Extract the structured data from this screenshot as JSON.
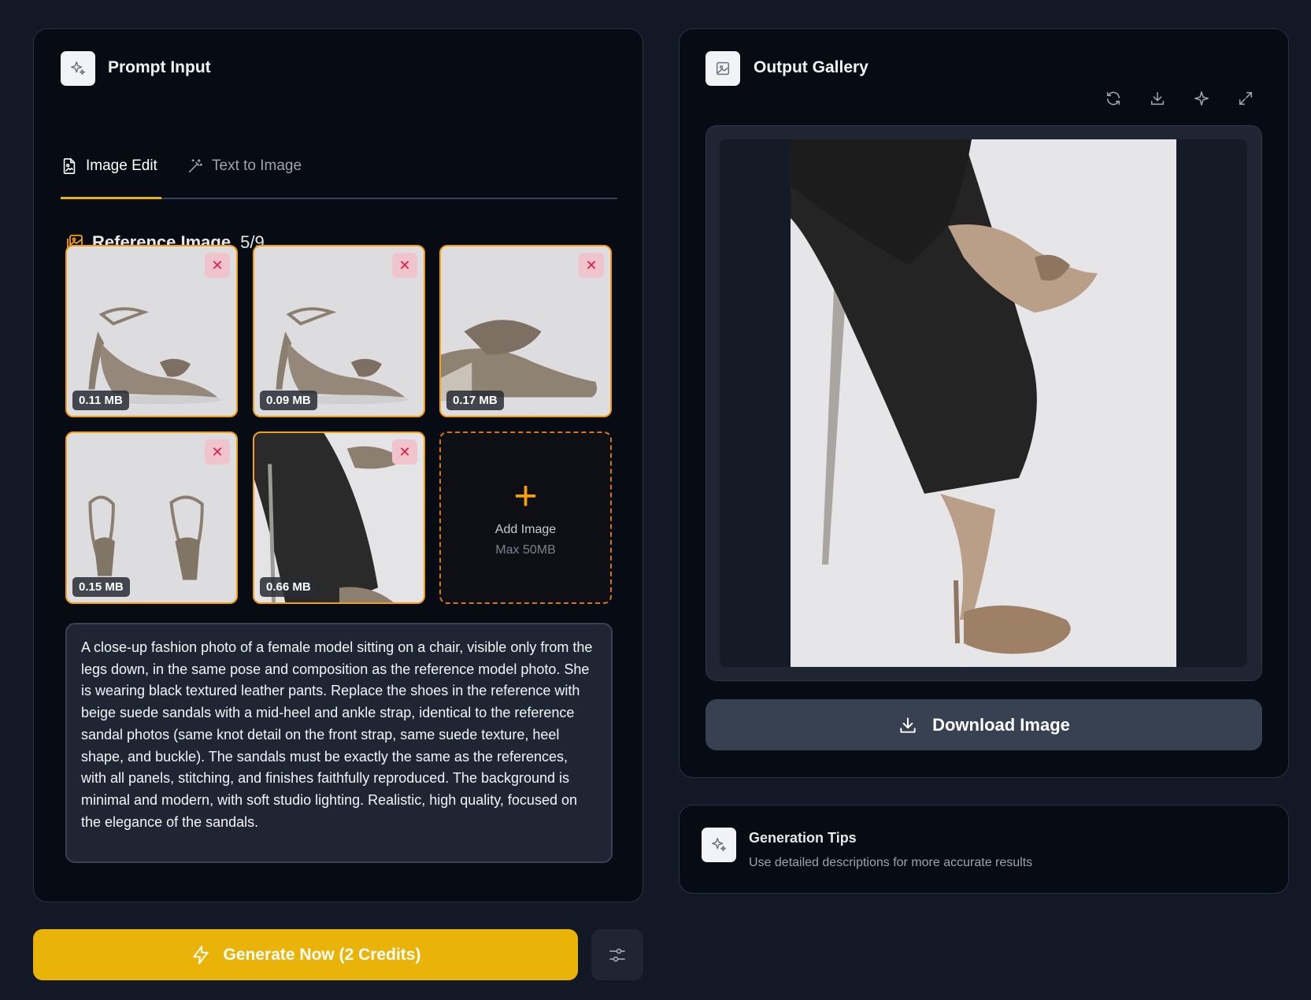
{
  "prompt_panel": {
    "title": "Prompt Input",
    "tabs": [
      {
        "label": "Image Edit",
        "active": true
      },
      {
        "label": "Text to Image",
        "active": false
      }
    ],
    "reference": {
      "label": "Reference Image",
      "count": "5/9",
      "images": [
        {
          "size": "0.11 MB",
          "subject": "sandal side view"
        },
        {
          "size": "0.09 MB",
          "subject": "sandal side view"
        },
        {
          "size": "0.17 MB",
          "subject": "sandal close-up"
        },
        {
          "size": "0.15 MB",
          "subject": "sandals back view"
        },
        {
          "size": "0.66 MB",
          "subject": "model legs leather pants"
        }
      ],
      "add_tile": {
        "label": "Add Image",
        "sublabel": "Max 50MB"
      }
    },
    "prompt_text": "A close-up fashion photo of a female model sitting on a chair, visible only from the legs down, in the same pose and composition as the reference model photo. She is wearing black textured leather pants. Replace the shoes in the reference with beige suede sandals with a mid-heel and ankle strap, identical to the reference sandal photos (same knot detail on the front strap, same suede texture, heel shape, and buckle). The sandals must be exactly the same as the references, with all panels, stitching, and finishes faithfully reproduced. The background is minimal and modern, with soft studio lighting. Realistic, high quality, focused on the elegance of the sandals."
  },
  "generate": {
    "label": "Generate Now (2 Credits)"
  },
  "gallery": {
    "title": "Output Gallery",
    "actions": [
      "refresh-icon",
      "download-icon",
      "sparkle-icon",
      "expand-icon"
    ],
    "download_label": "Download Image"
  },
  "tips": {
    "title": "Generation Tips",
    "text": "Use detailed descriptions for more accurate results"
  },
  "colors": {
    "accent": "#eab308",
    "thumb_border": "#f59e0b",
    "background": "#121826",
    "panel": "#070b14"
  }
}
